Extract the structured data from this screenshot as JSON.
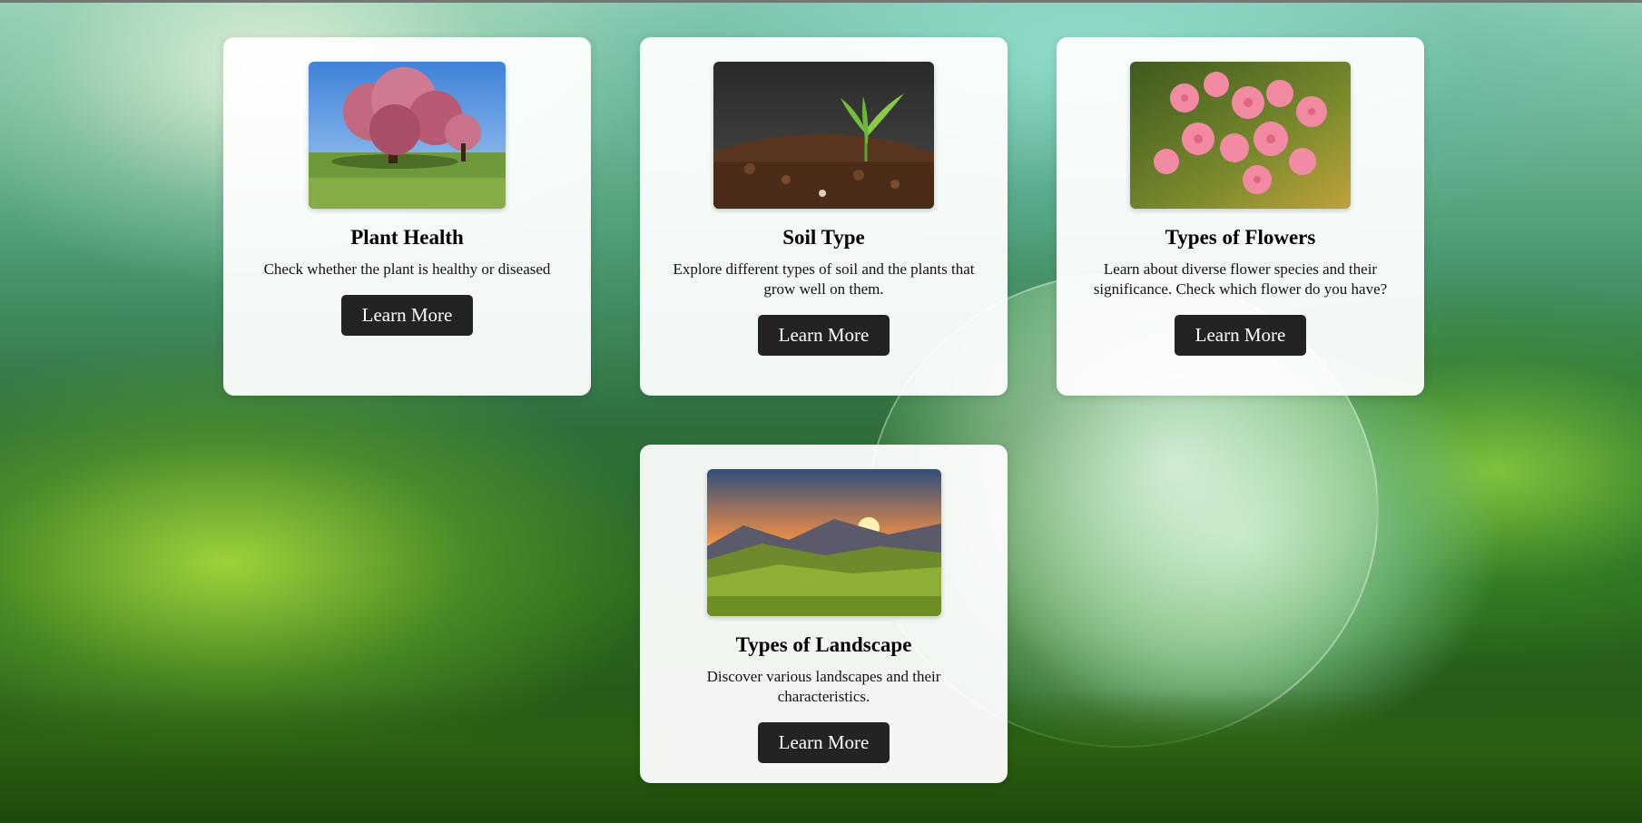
{
  "cards": [
    {
      "title": "Plant Health",
      "description": "Check whether the plant is healthy or diseased",
      "button_label": "Learn More",
      "image": "cherry-blossom-tree-image"
    },
    {
      "title": "Soil Type",
      "description": "Explore different types of soil and the plants that grow well on them.",
      "button_label": "Learn More",
      "image": "seedling-in-soil-image"
    },
    {
      "title": "Types of Flowers",
      "description": "Learn about diverse flower species and their significance. Check which flower do you have?",
      "button_label": "Learn More",
      "image": "pink-flowers-image"
    },
    {
      "title": "Types of Landscape",
      "description": "Discover various landscapes and their characteristics.",
      "button_label": "Learn More",
      "image": "sunset-landscape-image"
    }
  ],
  "colors": {
    "button_background": "#232323",
    "button_text": "#ffffff",
    "card_background": "#ffffff"
  }
}
